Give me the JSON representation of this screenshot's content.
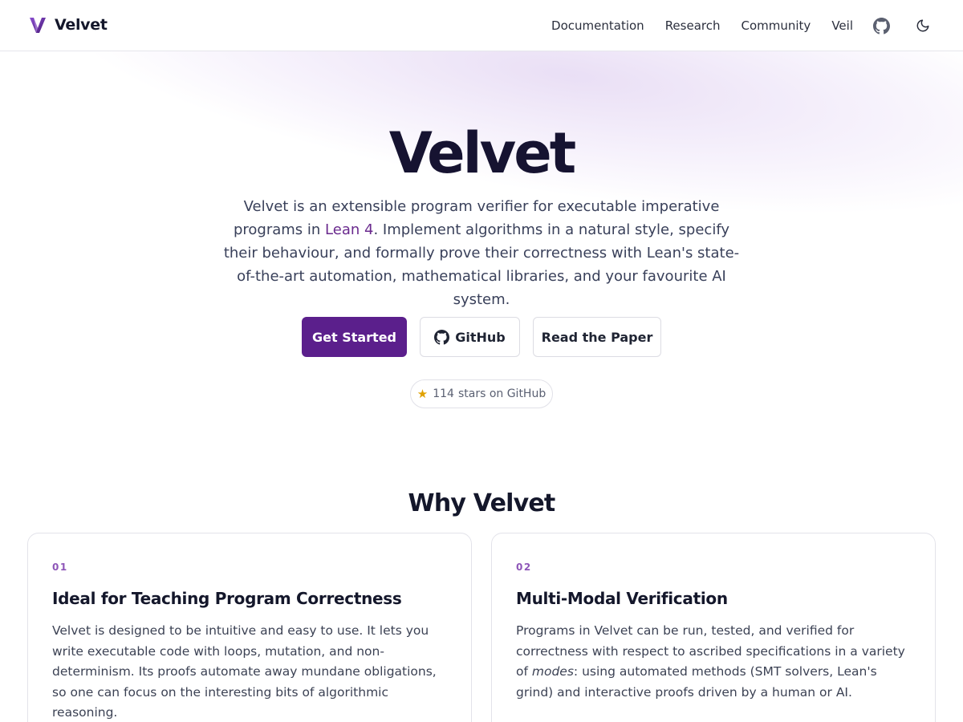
{
  "header": {
    "brand_name": "Velvet",
    "nav": [
      "Documentation",
      "Research",
      "Community",
      "Veil"
    ],
    "icons": [
      "github-icon",
      "moon-icon"
    ]
  },
  "hero": {
    "title": "Velvet",
    "description_pre": "Velvet is an extensible program verifier for executable imperative programs in ",
    "description_link": "Lean 4",
    "description_post": ". Implement algorithms in a natural style, specify their behaviour, and formally prove their correctness with Lean's state-of-the-art automation, mathematical libraries, and your favourite AI system.",
    "buttons": {
      "primary": "Get Started",
      "github": "GitHub",
      "paper": "Read the Paper"
    },
    "stars": {
      "icon": "star-icon",
      "count": "114",
      "label": "stars on GitHub"
    }
  },
  "why": {
    "title": "Why Velvet",
    "cards": [
      {
        "number": "01",
        "title": "Ideal for Teaching Program Correctness",
        "body": "Velvet is designed to be intuitive and easy to use. It lets you write executable code with loops, mutation, and non-determinism. Its proofs automate away mundane obligations, so one can focus on the interesting bits of algorithmic reasoning."
      },
      {
        "number": "02",
        "title": "Multi-Modal Verification",
        "body_pre": "Programs in Velvet can be run, tested, and verified for correctness with respect to ascribed specifications in a variety of ",
        "body_em": "modes",
        "body_post": ": using automated methods (SMT solvers, Lean's grind) and interactive proofs driven by a human or AI."
      }
    ]
  },
  "colors": {
    "accent": "#5b1f8c",
    "link": "#6a2a8e",
    "card_number": "#8e56b8",
    "star": "#e0a100"
  }
}
